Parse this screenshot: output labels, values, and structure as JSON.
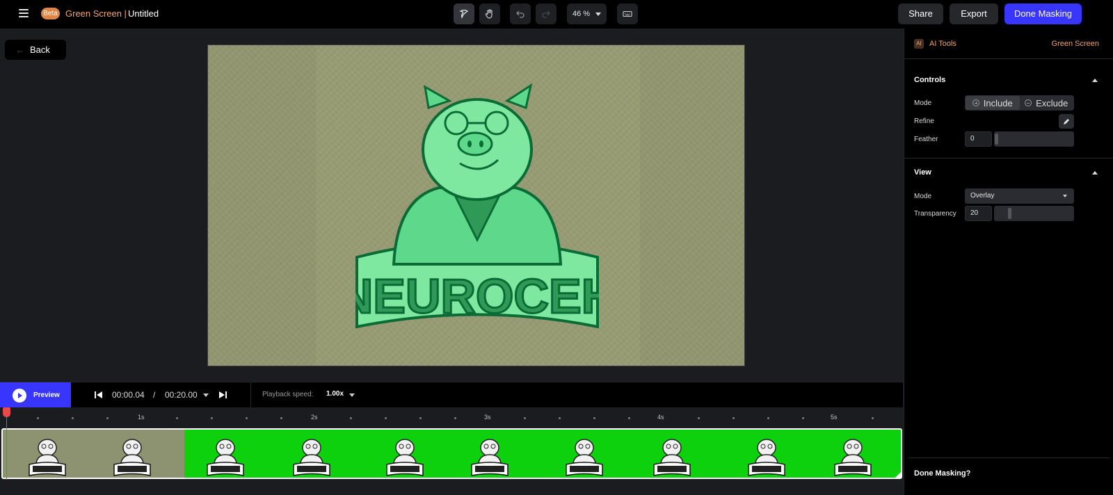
{
  "topbar": {
    "beta_label": "Beta",
    "app_name": "Green Screen |",
    "doc_title": "Untitled",
    "zoom": "46 %",
    "share_label": "Share",
    "export_label": "Export",
    "done_label": "Done Masking"
  },
  "canvas": {
    "back_label": "Back",
    "logo_text": "NEUROCEH"
  },
  "panel": {
    "ai_badge": "AI",
    "ai_tools_label": "AI Tools",
    "green_screen_label": "Green Screen",
    "controls": {
      "title": "Controls",
      "mode_label": "Mode",
      "include_label": "Include",
      "exclude_label": "Exclude",
      "refine_label": "Refine",
      "feather_label": "Feather",
      "feather_value": "0"
    },
    "view": {
      "title": "View",
      "mode_label": "Mode",
      "mode_value": "Overlay",
      "transparency_label": "Transparency",
      "transparency_value": "20"
    },
    "done_question": "Done Masking?"
  },
  "playback": {
    "preview_label": "Preview",
    "current_time": "00:00.04",
    "separator": "/",
    "total_time": "00:20.00",
    "speed_label": "Playback speed:",
    "speed_value": "1.00x"
  },
  "timeline": {
    "ticks": [
      "1s",
      "2s",
      "3s",
      "4s",
      "5s"
    ]
  },
  "colors": {
    "accent": "#3735ff",
    "brand_orange": "#f0a56a",
    "playhead": "#e84a4a",
    "green_screen": "#0ed10e"
  }
}
